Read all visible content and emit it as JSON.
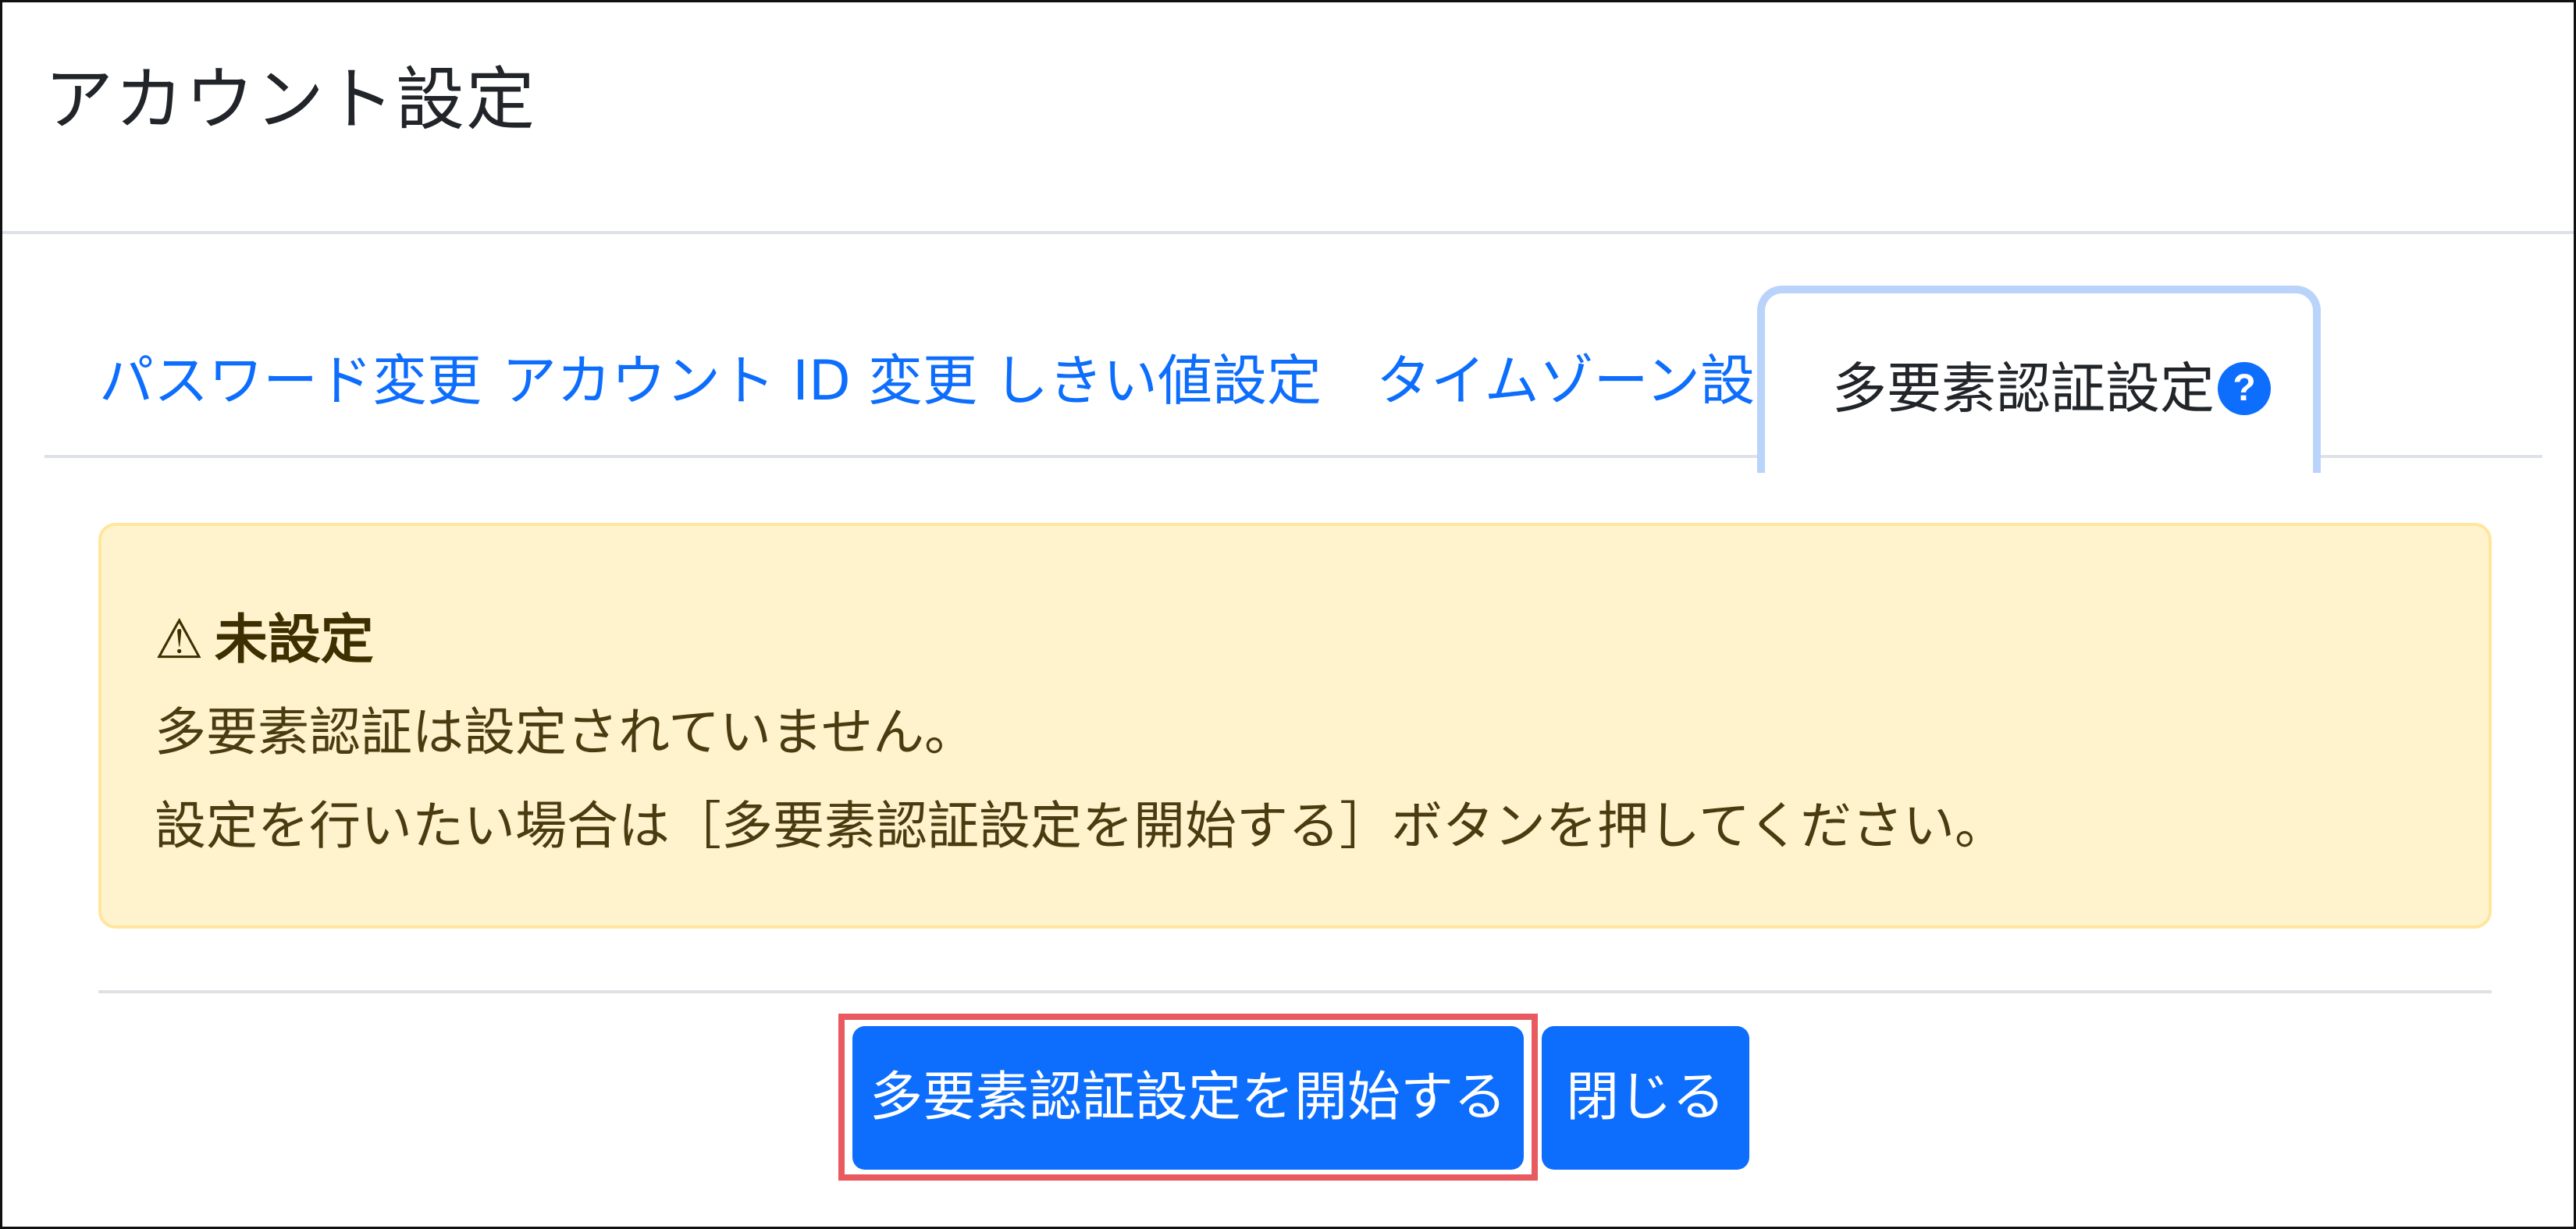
{
  "header": {
    "title": "アカウント設定"
  },
  "tabs": [
    {
      "label": "パスワード変更",
      "active": false
    },
    {
      "label": "アカウント ID 変更",
      "active": false
    },
    {
      "label": "しきい値設定",
      "active": false
    },
    {
      "label": "タイムゾーン設定",
      "active": false
    },
    {
      "label": "多要素認証設定",
      "active": true,
      "help_icon": "question-circle-icon",
      "help_glyph": "?"
    }
  ],
  "alert": {
    "icon": "warning-triangle-icon",
    "icon_glyph": "⚠",
    "heading": "未設定",
    "line1": "多要素認証は設定されていません。",
    "line2": "設定を行いたい場合は［多要素認証設定を開始する］ボタンを押してください。"
  },
  "buttons": {
    "start_label": "多要素認証設定を開始する",
    "close_label": "閉じる"
  },
  "colors": {
    "primary": "#0d6efd",
    "active_tab_border": "#b9d3fb",
    "alert_background": "#fff3cd",
    "highlight": "#e85a5f"
  }
}
